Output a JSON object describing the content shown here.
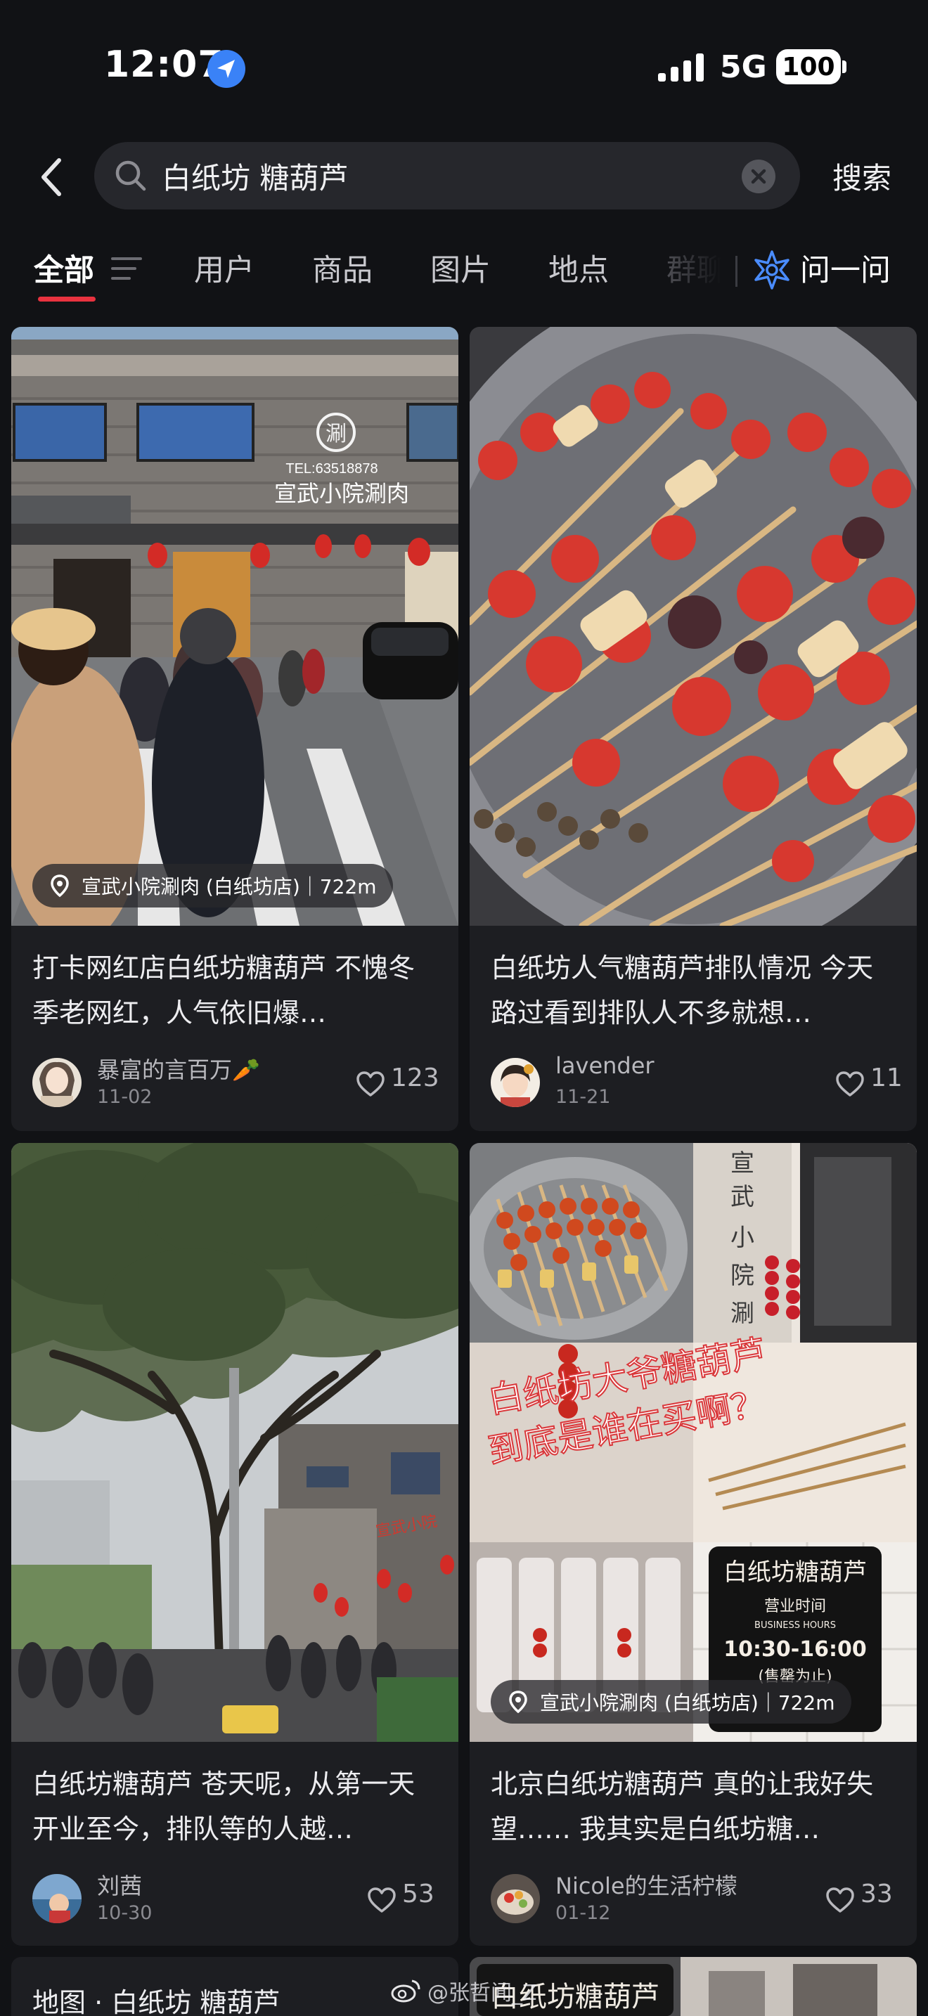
{
  "status_bar": {
    "time": "12:07",
    "network": "5G",
    "battery": "100"
  },
  "search": {
    "query": "白纸坊 糖葫芦",
    "submit_label": "搜索"
  },
  "tabs": [
    {
      "label": "全部"
    },
    {
      "label": "用户"
    },
    {
      "label": "商品"
    },
    {
      "label": "图片"
    },
    {
      "label": "地点"
    },
    {
      "label": "群聊"
    }
  ],
  "ask_label": "问一问",
  "posts": [
    {
      "title": "打卡网红店白纸坊糖葫芦 不愧冬季老网红，人气依旧爆…",
      "location": "宣武小院涮肉 (白纸坊店)｜722m",
      "author": "暴富的言百万🥕",
      "date": "11-02",
      "likes": "123",
      "sign_tel": "TEL:63518878",
      "sign_name": "宣武小院涮肉"
    },
    {
      "title": "白纸坊人气糖葫芦排队情况 今天路过看到排队人不多就想…",
      "author": "lavender",
      "date": "11-21",
      "likes": "11"
    },
    {
      "title": "白纸坊糖葫芦 苍天呢，从第一天开业至今，排队等的人越…",
      "author": "刘茜",
      "date": "10-30",
      "likes": "53"
    },
    {
      "title": "北京白纸坊糖葫芦 真的让我好失望…… 我其实是白纸坊糖…",
      "location": "宣武小院涮肉 (白纸坊店)｜722m",
      "author": "Nicole的生活柠檬",
      "date": "01-12",
      "likes": "33",
      "overlay_line1": "白纸坊大爷糖葫芦",
      "overlay_line2": "到底是谁在买啊？",
      "shop_sign": "白纸坊糖葫芦",
      "hours_title": "营业时间",
      "hours_en": "BUSINESS HOURS",
      "hours": "10:30-16:00",
      "hours_note": "(售罄为止)"
    }
  ],
  "bottom": {
    "map_label": "地图 · 白纸坊 糖葫芦",
    "right_sign": "白纸坊糖葫芦"
  },
  "watermark": "@张哲闻_Z",
  "colors": {
    "accent": "#e8323f",
    "background": "#111215",
    "card": "#1d1e22"
  }
}
